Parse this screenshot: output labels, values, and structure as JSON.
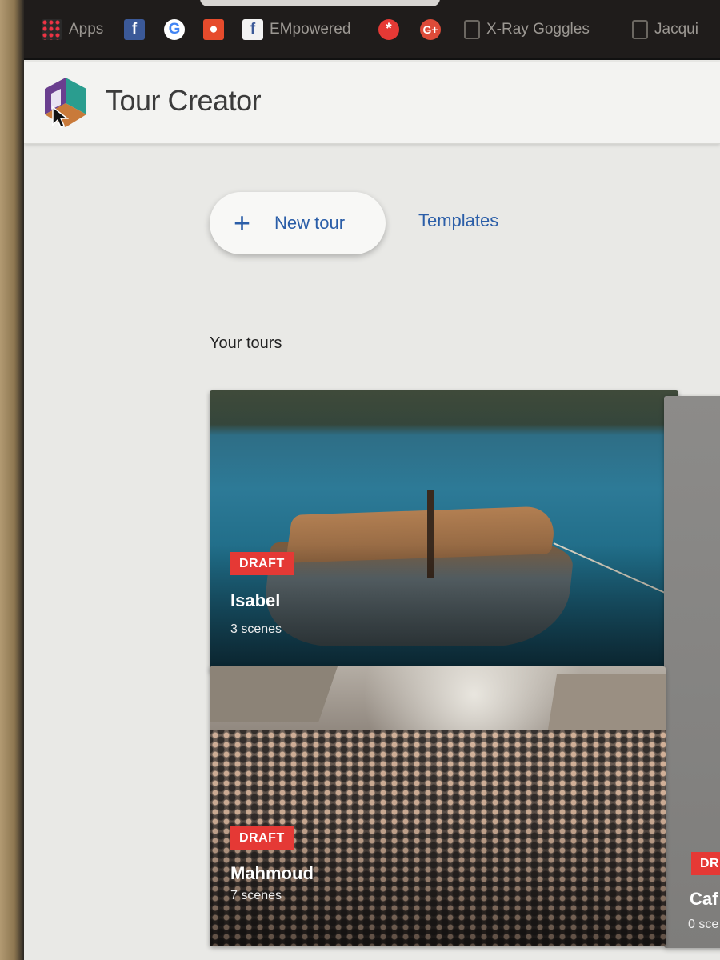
{
  "bookmarks": [
    {
      "label": "Apps",
      "icon": "apps-grid-icon"
    },
    {
      "label": "",
      "icon": "facebook-icon"
    },
    {
      "label": "",
      "icon": "google-icon"
    },
    {
      "label": "",
      "icon": "lightbulb-icon"
    },
    {
      "label": "EMpowered",
      "icon": "facebook-icon"
    },
    {
      "label": "",
      "icon": "asterisk-icon"
    },
    {
      "label": "",
      "icon": "google-plus-icon"
    },
    {
      "label": "X-Ray Goggles",
      "icon": "document-icon"
    },
    {
      "label": "Jacqui",
      "icon": "document-icon"
    }
  ],
  "header": {
    "title": "Tour Creator"
  },
  "actions": {
    "new_tour_label": "New tour",
    "templates_label": "Templates"
  },
  "section": {
    "title": "Your tours"
  },
  "tours": [
    {
      "status": "DRAFT",
      "name": "Isabel",
      "scenes": "3 scenes"
    },
    {
      "status": "DRAFT",
      "name": "Mahmoud",
      "scenes": "7 scenes"
    },
    {
      "status": "DR",
      "name": "Caf",
      "scenes": "0 sce"
    }
  ],
  "colors": {
    "accent": "#2b5ea8",
    "draft_badge": "#e53935",
    "header_bg": "#f3f3f1"
  }
}
